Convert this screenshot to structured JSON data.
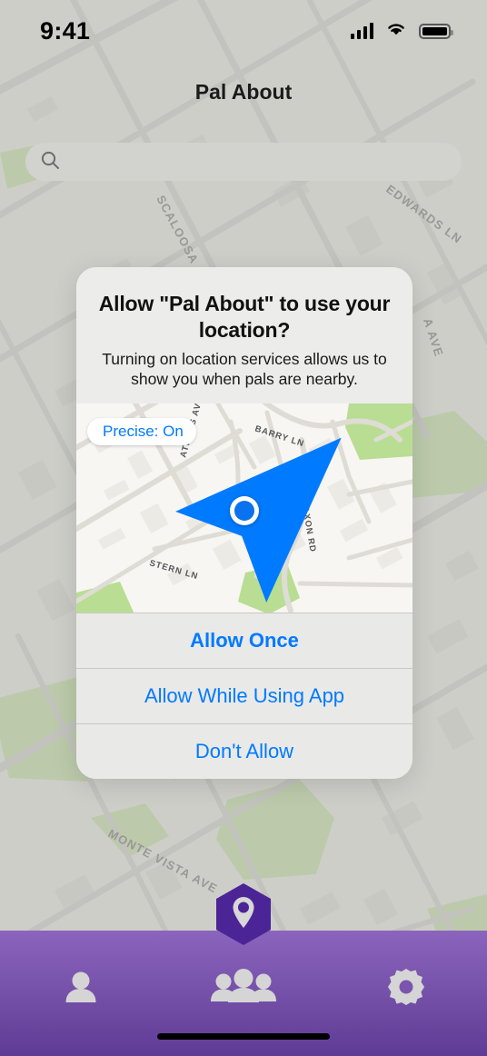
{
  "status_bar": {
    "time": "9:41",
    "signal_icon": "cellular-bars-icon",
    "wifi_icon": "wifi-icon",
    "battery_icon": "battery-full-icon"
  },
  "header": {
    "title": "Pal About"
  },
  "search": {
    "icon": "search-icon",
    "value": "",
    "placeholder": ""
  },
  "alert": {
    "title": "Allow \"Pal About\" to use your location?",
    "message": "Turning on location services allows us to show you when pals are nearby.",
    "map": {
      "precise_label": "Precise: On",
      "precise_icon": "navigation-arrow-icon",
      "user_location_icon": "blue-location-dot",
      "street_labels": [
        "BARRY LN",
        "ATHENS AVE",
        "FAXON RD",
        "STERN LN"
      ]
    },
    "buttons": [
      {
        "label": "Allow Once",
        "emphasis": "bold"
      },
      {
        "label": "Allow While Using App",
        "emphasis": "regular"
      },
      {
        "label": "Don't Allow",
        "emphasis": "regular"
      }
    ]
  },
  "background_map": {
    "street_labels": [
      "SCALOOSA AVE",
      "EDWARDS LN",
      "MONTE VISTA AVE",
      "A AVE"
    ]
  },
  "app_logo": {
    "icon": "map-pin-hexagon-icon"
  },
  "tab_bar": {
    "items": [
      {
        "icon": "person-icon",
        "name": "profile"
      },
      {
        "icon": "people-group-icon",
        "name": "pals"
      },
      {
        "icon": "gear-icon",
        "name": "settings"
      }
    ]
  },
  "colors": {
    "accent_blue": "#007AFF",
    "brand_purple": "#4B2596",
    "tab_bar_purple": "#7a55ad",
    "map_land": "#e7e6e1",
    "map_park_green": "#b5dd8d",
    "alert_background": "#ececeb"
  }
}
